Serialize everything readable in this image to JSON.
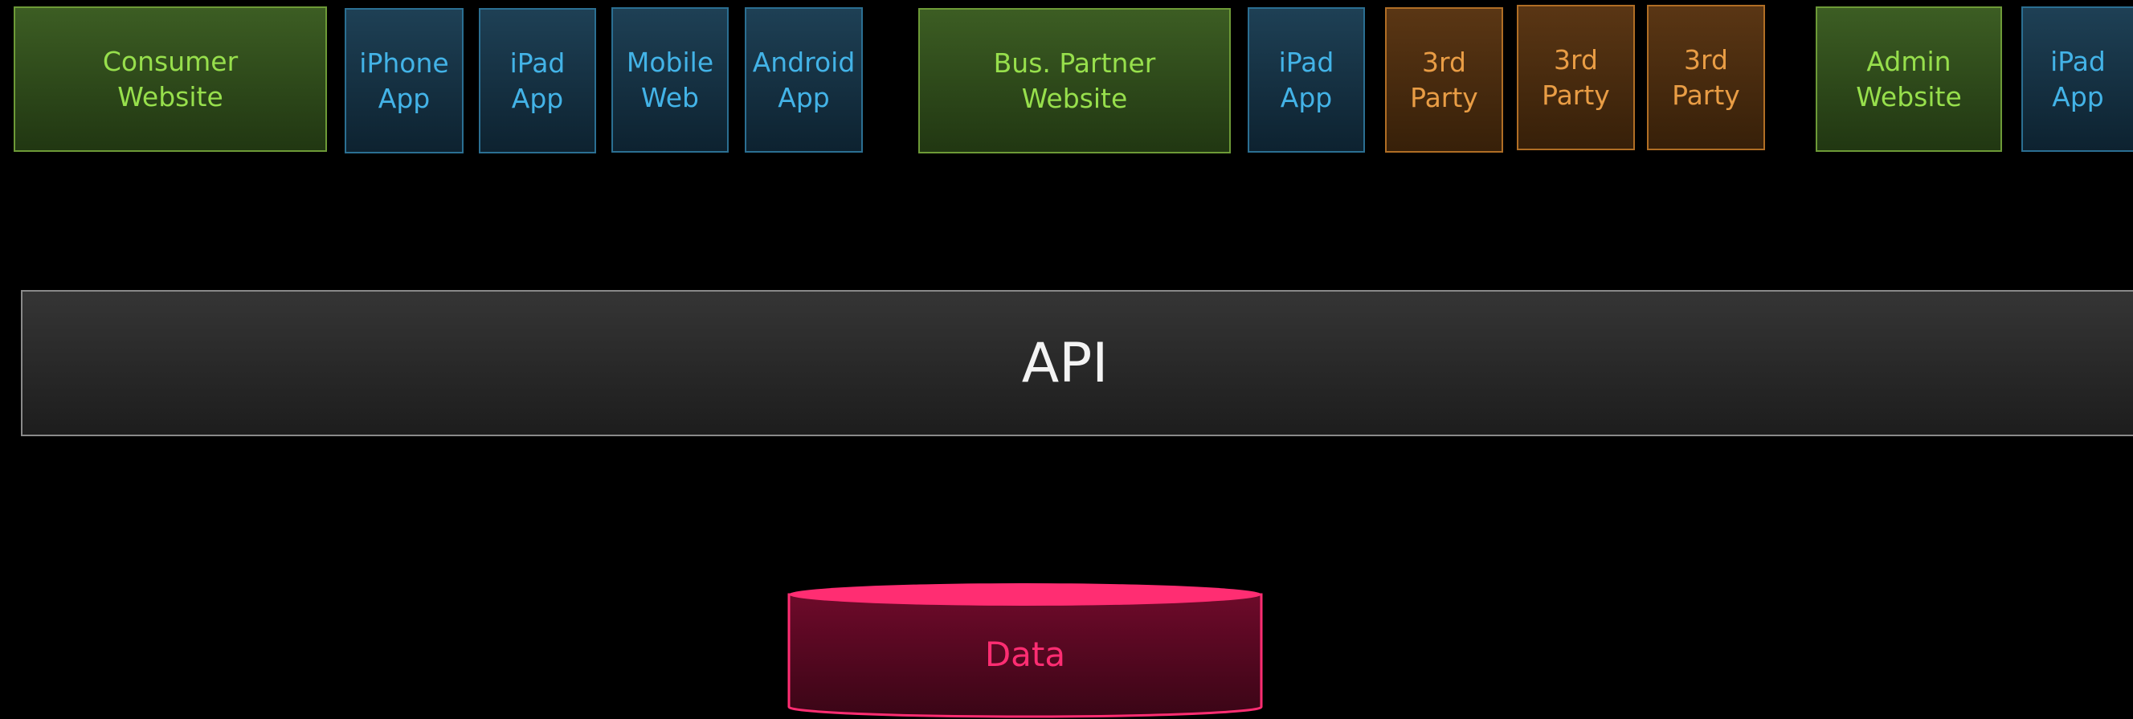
{
  "clients": {
    "consumer_website": "Consumer\nWebsite",
    "iphone_app": "iPhone\nApp",
    "ipad_app_1": "iPad\nApp",
    "mobile_web": "Mobile\nWeb",
    "android_app": "Android\nApp",
    "bus_partner_website": "Bus. Partner\nWebsite",
    "ipad_app_2": "iPad\nApp",
    "third_party_1": "3rd\nParty",
    "third_party_2": "3rd\nParty",
    "third_party_3": "3rd\nParty",
    "admin_website": "Admin\nWebsite",
    "ipad_app_3": "iPad\nApp"
  },
  "api": {
    "label": "API"
  },
  "data_store": {
    "label": "Data"
  },
  "colors": {
    "background": "#000000",
    "website_green": "#97df4c",
    "app_blue": "#43b3e7",
    "third_party_orange": "#e99d45",
    "data_pink": "#ff2d72"
  }
}
